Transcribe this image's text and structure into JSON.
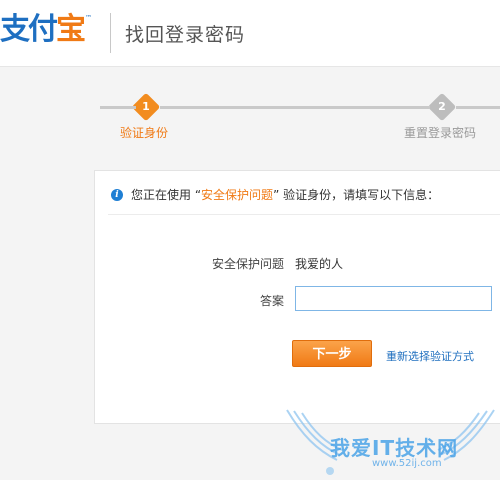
{
  "header": {
    "logo_prefix": "支付",
    "logo_suffix": "宝",
    "logo_tm": "™",
    "title": "找回登录密码"
  },
  "steps": [
    {
      "number": "1",
      "label": "验证身份",
      "active": true
    },
    {
      "number": "2",
      "label": "重置登录密码",
      "active": false
    }
  ],
  "info": {
    "icon": "info-icon",
    "prefix": "您正在使用 “",
    "highlight": "安全保护问题",
    "suffix": "” 验证身份，请填写以下信息："
  },
  "form": {
    "question_label": "安全保护问题",
    "question_value": "我爱的人",
    "answer_label": "答案",
    "answer_value": "",
    "next_button": "下一步",
    "reselect_link": "重新选择验证方式"
  },
  "watermark": {
    "text": "我爱IT技术网",
    "url": "www.52ij.com"
  },
  "colors": {
    "accent_orange": "#f07a15",
    "brand_blue": "#1e6fc1",
    "link_blue": "#1f6fbf"
  }
}
